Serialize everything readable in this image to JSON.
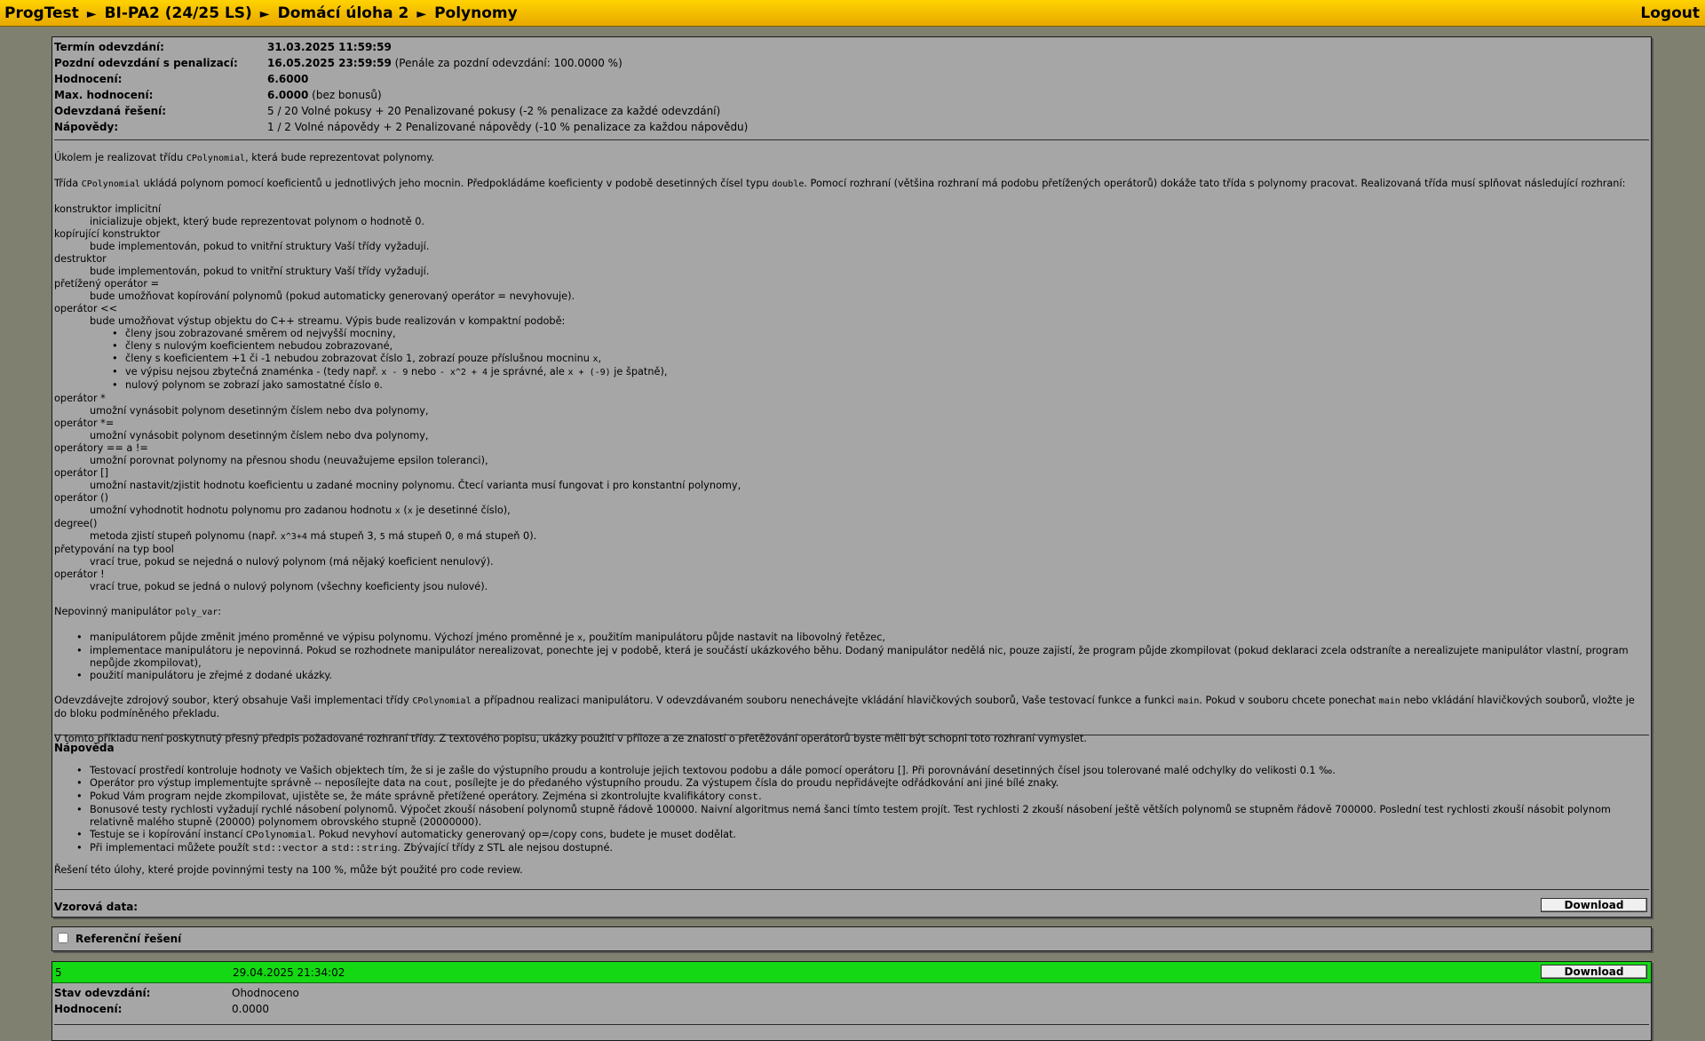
{
  "breadcrumb": [
    "ProgTest",
    "BI-PA2 (24/25 LS)",
    "Domácí úloha 2",
    "Polynomy"
  ],
  "breadcrumb_separator": "►",
  "logout_label": "Logout",
  "meta": {
    "deadline_label": "Termín odevzdání:",
    "deadline_value": "31.03.2025 11:59:59",
    "late_label": "Pozdní odevzdání s penalizací:",
    "late_value": "16.05.2025 23:59:59",
    "late_note": "(Penále za pozdní odevzdání: 100.0000 %)",
    "score_label": "Hodnocení:",
    "score_value": "6.6000",
    "max_label": "Max. hodnocení:",
    "max_value": "6.0000",
    "max_note": "(bez bonusů)",
    "submitted_label": "Odevzdaná řešení:",
    "submitted_value": "5 / 20 Volné pokusy + 20 Penalizované pokusy (-2 % penalizace za každé odevzdání)",
    "hints_label": "Nápovědy:",
    "hints_value": "1 / 2 Volné nápovědy + 2 Penalizované nápovědy (-10 % penalizace za každou nápovědu)"
  },
  "text": {
    "intro_a": "Úkolem je realizovat třídu ",
    "intro_code": "CPolynomial",
    "intro_b": ", která bude reprezentovat polynomy.",
    "p2_a": "Třída ",
    "p2_code1": "CPolynomial",
    "p2_b": " ukládá polynom pomocí koeficientů u jednotlivých jeho mocnin. Předpokládáme koeficienty v podobě desetinných čísel typu ",
    "p2_code2": "double",
    "p2_c": ". Pomocí rozhraní (většina rozhraní má podobu přetížených operátorů) dokáže tato třída s polynomy pracovat. Realizovaná třída musí splňovat následující rozhraní:",
    "d_ctor_t": "konstruktor implicitní",
    "d_ctor_d": "inicializuje objekt, který bude reprezentovat polynom o hodnotě 0.",
    "d_copy_t": "kopírující konstruktor",
    "d_copy_d": "bude implementován, pokud to vnitřní struktury Vaší třídy vyžadují.",
    "d_dtor_t": "destruktor",
    "d_dtor_d": "bude implementován, pokud to vnitřní struktury Vaší třídy vyžadují.",
    "d_assign_t": "přetížený operátor =",
    "d_assign_d": "bude umožňovat kopírování polynomů (pokud automaticky generovaný operátor = nevyhovuje).",
    "d_out_t": "operátor <<",
    "d_out_d": "bude umožňovat výstup objektu do C++ streamu. Výpis bude realizován v kompaktní podobě:",
    "d_out_li1": "členy jsou zobrazované směrem od nejvyšší mocniny,",
    "d_out_li2": "členy s nulovým koeficientem nebudou zobrazované,",
    "d_out_li3a": "členy s koeficientem +1 či -1 nebudou zobrazovat číslo 1, zobrazí pouze příslušnou mocninu ",
    "d_out_li3code": "x",
    "d_out_li3b": ",",
    "d_out_li4a": "ve výpisu nejsou zbytečná znaménka - (tedy např. ",
    "d_out_li4code1": "x - 9",
    "d_out_li4b": " nebo ",
    "d_out_li4code2": "- x^2 + 4",
    "d_out_li4c": " je správné, ale ",
    "d_out_li4code3": "x + (-9)",
    "d_out_li4d": " je špatně),",
    "d_out_li5a": "nulový polynom se zobrazí jako samostatné číslo ",
    "d_out_li5code": "0",
    "d_out_li5b": ".",
    "d_mul_t": "operátor *",
    "d_mul_d": "umožní vynásobit polynom desetinným číslem nebo dva polynomy,",
    "d_mula_t": "operátor *=",
    "d_mula_d": "umožní vynásobit polynom desetinným číslem nebo dva polynomy,",
    "d_eq_t": "operátory == a !=",
    "d_eq_d": "umožní porovnat polynomy na přesnou shodu (neuvažujeme epsilon toleranci),",
    "d_idx_t": "operátor []",
    "d_idx_d": "umožní nastavit/zjistit hodnotu koeficientu u zadané mocniny polynomu. Čtecí varianta musí fungovat i pro konstantní polynomy,",
    "d_call_t": "operátor ()",
    "d_call_da": "umožní vyhodnotit hodnotu polynomu pro zadanou hodnotu ",
    "d_call_code1": "x",
    "d_call_db": " (",
    "d_call_code2": "x",
    "d_call_dc": " je desetinné číslo),",
    "d_deg_t": "degree()",
    "d_deg_da": "metoda zjistí stupeň polynomu (např. ",
    "d_deg_code1": "x^3+4",
    "d_deg_db": " má stupeň 3, ",
    "d_deg_code2": "5",
    "d_deg_dc": " má stupeň 0, ",
    "d_deg_code3": "0",
    "d_deg_dd": " má stupeň 0).",
    "d_bool_t": "přetypování na typ bool",
    "d_bool_d": "vrací true, pokud se nejedná o nulový polynom (má nějaký koeficient nenulový).",
    "d_not_t": "operátor !",
    "d_not_d": "vrací true, pokud se jedná o nulový polynom (všechny koeficienty jsou nulové).",
    "manip_a": "Nepovinný manipulátor ",
    "manip_code": "poly_var",
    "manip_b": ":",
    "m_li1a": "manipulátorem půjde změnit jméno proměnné ve výpisu polynomu. Výchozí jméno proměnné je ",
    "m_li1code": "x",
    "m_li1b": ", použitím manipulátoru půjde nastavit na libovolný řetězec,",
    "m_li2": "implementace manipulátoru je nepovinná. Pokud se rozhodnete manipulátor nerealizovat, ponechte jej v podobě, která je součástí ukázkového běhu. Dodaný manipulátor nedělá nic, pouze zajistí, že program půjde zkompilovat (pokud deklaraci zcela odstraníte a nerealizujete manipulátor vlastní, program nepůjde zkompilovat),",
    "m_li3": "použití manipulátoru je zřejmé z dodané ukázky.",
    "sub_a": "Odevzdávejte zdrojový soubor, který obsahuje Vaši implementaci třídy ",
    "sub_code1": "CPolynomial",
    "sub_b": " a případnou realizaci manipulátoru. V odevzdávaném souboru nenechávejte vkládání hlavičkových souborů, Vaše testovací funkce a funkci ",
    "sub_code2": "main",
    "sub_c": ". Pokud v souboru chcete ponechat ",
    "sub_code3": "main",
    "sub_d": " nebo vkládání hlavičkových souborů, vložte je do bloku podmíněného překladu.",
    "nopre": "V tomto příkladu není poskytnutý přesný předpis požadované rozhraní třídy. Z textového popisu, ukázky použití v příloze a ze znalostí o přetěžování operátorů byste měli být schopni toto rozhraní vymyslet.",
    "help_title": "Nápověda",
    "h1": "Testovací prostředí kontroluje hodnoty ve Vašich objektech tím, že si je zašle do výstupního proudu a kontroluje jejich textovou podobu a dále pomocí operátoru []. Při porovnávání desetinných čísel jsou tolerované malé odchylky do velikosti 0.1 ‰.",
    "h2a": "Operátor pro výstup implementujte správně -- neposílejte data na ",
    "h2code": "cout",
    "h2b": ", posílejte je do předaného výstupního proudu. Za výstupem čísla do proudu nepřidávejte odřádkování ani jiné bílé znaky.",
    "h3a": "Pokud Vám program nejde zkompilovat, ujistěte se, že máte správně přetížené operátory. Zejména si zkontrolujte kvalifikátory ",
    "h3code": "const",
    "h3b": ".",
    "h4": "Bonusové testy rychlosti vyžadují rychlé násobení polynomů. Výpočet zkouší násobení polynomů stupně řádově 100000. Naivní algoritmus nemá šanci tímto testem projít. Test rychlosti 2 zkouší násobení ještě větších polynomů se stupněm řádově 700000. Poslední test rychlosti zkouší násobit polynom relativně malého stupně (20000) polynomem obrovského stupně (20000000).",
    "h5a": "Testuje se i kopírování instancí ",
    "h5code": "CPolynomial",
    "h5b": ". Pokud nevyhoví automaticky generovaný op=/copy cons, budete je muset dodělat.",
    "h6a": "Při implementaci můžete použít ",
    "h6code1": "std::vector",
    "h6b": " a ",
    "h6code2": "std::string",
    "h6c": ". Zbývající třídy z STL ale nejsou dostupné.",
    "review": "Řešení této úlohy, které projde povinnými testy na 100 %, může být použité pro code review."
  },
  "sample_label": "Vzorová data:",
  "download_label": "Download",
  "reference_label": "Referenční řešení",
  "submission": {
    "number": "5",
    "date": "29.04.2025 21:34:02",
    "status_label": "Stav odevzdání:",
    "status_value": "Ohodnoceno",
    "score_label": "Hodnocení:",
    "score_value": "0.0000",
    "status_color": "#14d814"
  },
  "colors": {
    "header": "#f5c000",
    "panel": "#a6a6a6",
    "page": "#808070"
  }
}
